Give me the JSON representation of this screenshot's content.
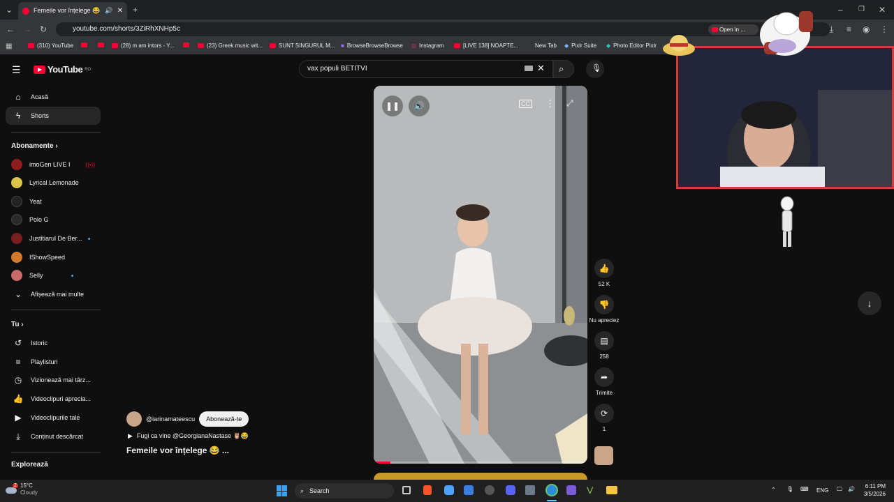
{
  "browser": {
    "tab_title": "Femeile vor înțelege 😂 @i",
    "url": "youtube.com/shorts/3ZiRhXNHp5c",
    "open_in_app": "Open in ...",
    "bookmarks": [
      "(310) YouTube",
      "(28) m am intors - Y...",
      "(23) Greek music wit...",
      "SUNT SINGURUL M...",
      "BrowseBrowseBrowse",
      "Instagram",
      "[LIVE 138] NOAPTE...",
      "New Tab",
      "Pixlr Suite",
      "Photo Editor Pixlr"
    ]
  },
  "youtube": {
    "logo": "YouTube",
    "region": "RO",
    "search_value": "vax populi BETITVI"
  },
  "sidebar": {
    "main": [
      {
        "label": "Acasă",
        "icon": "home-icon"
      },
      {
        "label": "Shorts",
        "icon": "shorts-icon"
      }
    ],
    "subscriptions_title": "Abonamente",
    "subscriptions": [
      {
        "label": "imoGen LIVE I",
        "color": "#8b1e1e",
        "live": true
      },
      {
        "label": "Lyrical Lemonade",
        "color": "#d8c54a"
      },
      {
        "label": "Yeat",
        "color": "#222222"
      },
      {
        "label": "Polo G",
        "color": "#2a2a2a"
      },
      {
        "label": "Justitiarul De Ber...",
        "color": "#7a1f1f",
        "new": true
      },
      {
        "label": "IShowSpeed",
        "color": "#d47b2b"
      },
      {
        "label": "Selly",
        "color": "#c96b6b",
        "new": true
      }
    ],
    "show_more": "Afișează mai multe",
    "you_title": "Tu",
    "you": [
      {
        "label": "Istoric",
        "icon": "history-icon"
      },
      {
        "label": "Playlisturi",
        "icon": "playlist-icon"
      },
      {
        "label": "Vizionează mai târz...",
        "icon": "clock-icon"
      },
      {
        "label": "Videoclipuri aprecia...",
        "icon": "like-icon"
      },
      {
        "label": "Videoclipurile tale",
        "icon": "video-icon"
      },
      {
        "label": "Conținut descărcat",
        "icon": "download-icon"
      }
    ],
    "explore_title": "Explorează"
  },
  "short": {
    "channel": "@iarinamateescu",
    "subscribe": "Abonează-te",
    "music": "Fugi ca vine @GeorgianaNastase 🦉😂",
    "title": "Femeile vor înțelege 😂 ...",
    "progress": 0.08
  },
  "actions": {
    "likes": "52 K",
    "dislike": "Nu apreciez",
    "comments": "258",
    "share": "Trimite",
    "remix": "1"
  },
  "taskbar": {
    "temp": "15°C",
    "weather": "Cloudy",
    "search": "Search",
    "lang": "ENG",
    "time": "6:11 PM",
    "date": "3/5/2026",
    "notif": "2"
  }
}
